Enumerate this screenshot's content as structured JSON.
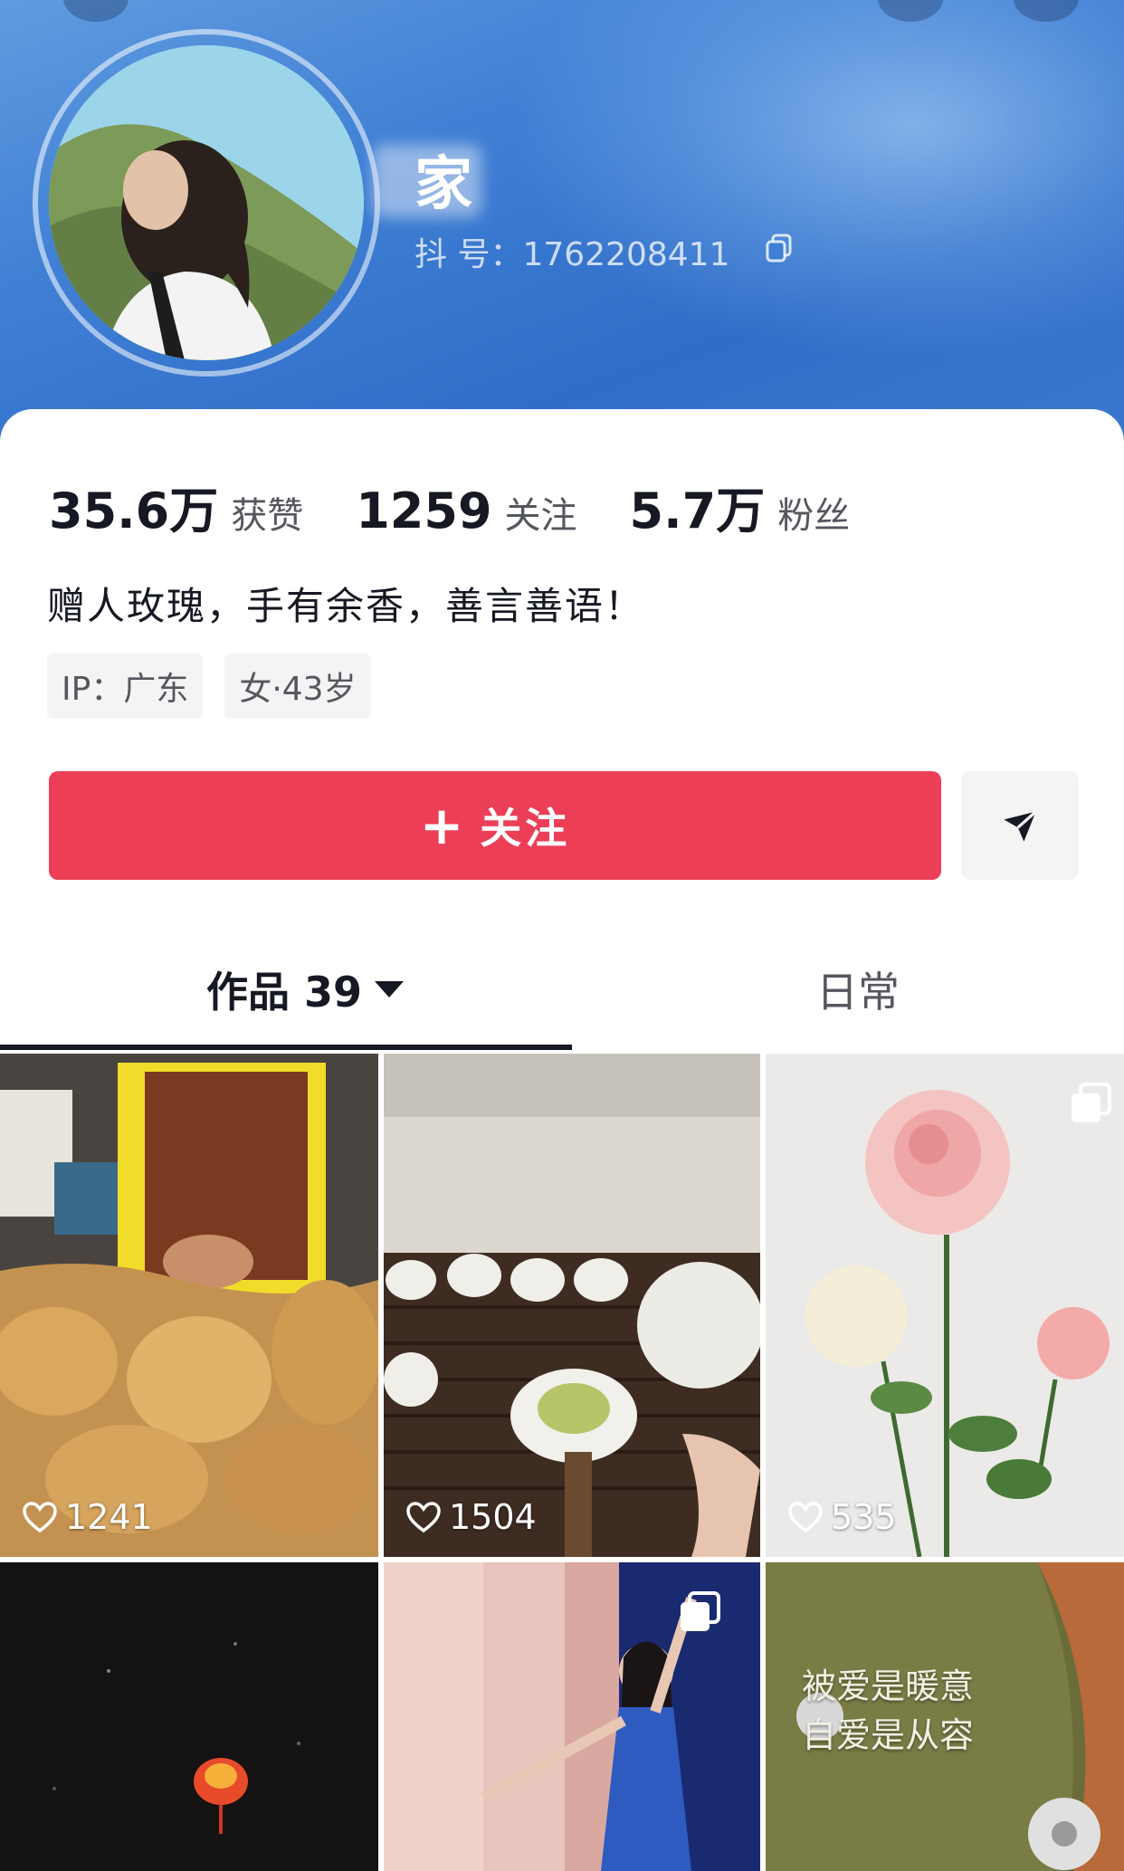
{
  "profile": {
    "nickname": "家",
    "account_id": "抖 号：1762208411",
    "bio": "赠人玫瑰，手有余香，善言善语！",
    "tags": [
      "IP：广东",
      "女·43岁"
    ]
  },
  "stats": [
    {
      "value": "35.6万",
      "label": "获赞"
    },
    {
      "value": "1259",
      "label": "关注"
    },
    {
      "value": "5.7万",
      "label": "粉丝"
    }
  ],
  "actions": {
    "follow_label": "关注",
    "follow_plus": "+"
  },
  "tabs": {
    "works_label": "作品 39",
    "daily_label": "日常"
  },
  "posts": [
    {
      "likes": "1241"
    },
    {
      "likes": "1504"
    },
    {
      "likes": "535"
    },
    {
      "likes": ""
    },
    {
      "likes": ""
    },
    {
      "likes": "",
      "overlay_line1": "被爱是暖意",
      "overlay_line2": "自爱是从容"
    }
  ],
  "colors": {
    "follow_button": "#ec3f57",
    "header_blue": "#3f7fd4"
  }
}
